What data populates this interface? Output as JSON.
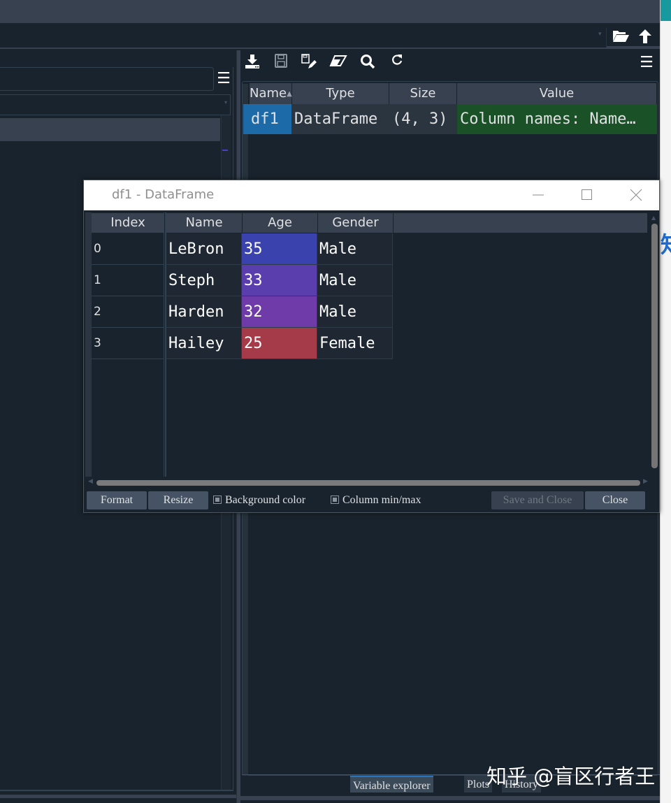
{
  "top_toolbar": {
    "open_folder_icon": "folder-open-icon",
    "parent_dir_icon": "arrow-up-icon"
  },
  "variable_explorer": {
    "toolbar_icons": [
      "import-data-icon",
      "save-icon",
      "save-as-icon",
      "eraser-icon",
      "search-icon",
      "refresh-icon",
      "menu-icon"
    ],
    "columns": [
      "Name",
      "Type",
      "Size",
      "Value"
    ],
    "sort_indicator": "ascending",
    "rows": [
      {
        "name": "df1",
        "type": "DataFrame",
        "size": "(4, 3)",
        "value": "Column names: Name…"
      }
    ],
    "colors": {
      "name_cell": "#1d6aa8",
      "value_cell": "#1a5127",
      "type_cell": "#2b3540"
    }
  },
  "bottom_tabs": [
    {
      "label": "Variable explorer",
      "active": true
    },
    {
      "label": "Plots",
      "active": false
    },
    {
      "label": "History",
      "active": false
    }
  ],
  "watermark": "知乎 @盲区行者王",
  "dialog": {
    "title": "df1 - DataFrame",
    "window_controls": {
      "minimize": "—",
      "maximize": "☐",
      "close": "✕"
    },
    "index_header": "Index",
    "columns": [
      "Name",
      "Age",
      "Gender"
    ],
    "rows": [
      {
        "index": "0",
        "Name": "LeBron",
        "Age": "35",
        "Gender": "Male",
        "age_color": "#3a42ad"
      },
      {
        "index": "1",
        "Name": "Steph",
        "Age": "33",
        "Gender": "Male",
        "age_color": "#5b3eae"
      },
      {
        "index": "2",
        "Name": "Harden",
        "Age": "32",
        "Gender": "Male",
        "age_color": "#6e3ba9"
      },
      {
        "index": "3",
        "Name": "Hailey",
        "Age": "25",
        "Gender": "Female",
        "age_color": "#a53b48"
      }
    ],
    "buttons": {
      "format": "Format",
      "resize": "Resize",
      "save_and_close": "Save and Close",
      "close": "Close"
    },
    "checkboxes": [
      {
        "label": "Background color",
        "checked": true
      },
      {
        "label": "Column min/max",
        "checked": true
      }
    ]
  }
}
